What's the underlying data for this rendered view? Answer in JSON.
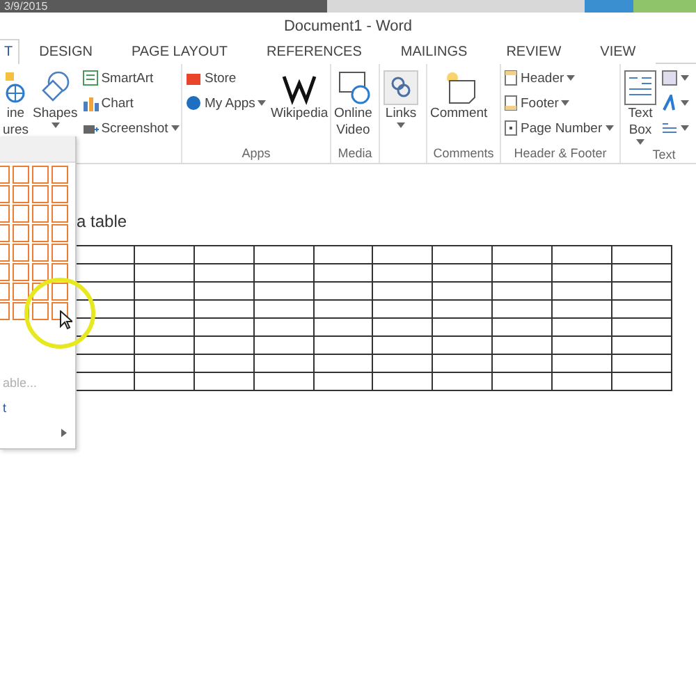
{
  "video_bar": {
    "date": "3/9/2015"
  },
  "window": {
    "title": "Document1 - Word"
  },
  "tabs": [
    {
      "label": "T",
      "selected": true
    },
    {
      "label": "DESIGN",
      "selected": false
    },
    {
      "label": "PAGE LAYOUT",
      "selected": false
    },
    {
      "label": "REFERENCES",
      "selected": false
    },
    {
      "label": "MAILINGS",
      "selected": false
    },
    {
      "label": "REVIEW",
      "selected": false
    },
    {
      "label": "VIEW",
      "selected": false
    }
  ],
  "ribbon": {
    "groups": [
      {
        "buttons": [
          {
            "kind": "large",
            "lines": [
              "ine",
              "ures"
            ]
          },
          {
            "kind": "large",
            "lines": [
              "Shapes"
            ],
            "dropdown": true
          },
          {
            "kind": "stack",
            "items": [
              {
                "label": "SmartArt"
              },
              {
                "label": "Chart"
              },
              {
                "label": "Screenshot",
                "dropdown": true
              }
            ]
          }
        ]
      },
      {
        "label": "Apps",
        "buttons": [
          {
            "kind": "stack",
            "items": [
              {
                "label": "Store"
              },
              {
                "label": "My Apps",
                "dropdown": true
              }
            ]
          },
          {
            "kind": "large",
            "lines": [
              "Wikipedia"
            ]
          }
        ]
      },
      {
        "label": "Media",
        "buttons": [
          {
            "kind": "large",
            "lines": [
              "Online",
              "Video"
            ]
          }
        ]
      },
      {
        "buttons": [
          {
            "kind": "large",
            "lines": [
              "Links"
            ],
            "dropdown": true
          }
        ]
      },
      {
        "label": "Comments",
        "buttons": [
          {
            "kind": "large",
            "lines": [
              "Comment"
            ]
          }
        ]
      },
      {
        "label": "Header & Footer",
        "buttons": [
          {
            "kind": "stack",
            "items": [
              {
                "label": "Header",
                "dropdown": true
              },
              {
                "label": "Footer",
                "dropdown": true
              },
              {
                "label": "Page Number",
                "dropdown": true
              }
            ]
          }
        ]
      },
      {
        "label": "Text",
        "buttons": [
          {
            "kind": "large",
            "lines": [
              "Text",
              "Box"
            ],
            "dropdown": true
          },
          {
            "kind": "stack",
            "items": [
              {
                "dropdown": true
              },
              {
                "dropdown": true
              },
              {
                "dropdown": true
              }
            ]
          }
        ]
      }
    ]
  },
  "document": {
    "heading": "a table"
  },
  "table_menu": {
    "grid": [
      [
        true,
        true,
        true,
        true
      ],
      [
        true,
        true,
        true,
        true
      ],
      [
        true,
        true,
        true,
        true
      ],
      [
        true,
        true,
        true,
        true
      ],
      [
        true,
        true,
        true,
        true
      ],
      [
        true,
        true,
        true,
        true
      ],
      [
        true,
        true,
        true,
        true
      ],
      [
        true,
        true,
        true,
        true
      ]
    ],
    "items": [
      {
        "kind": "text",
        "label": "able...",
        "disabled": true
      },
      {
        "kind": "text",
        "label": "t",
        "disabled": false
      },
      {
        "kind": "submenu"
      }
    ]
  }
}
